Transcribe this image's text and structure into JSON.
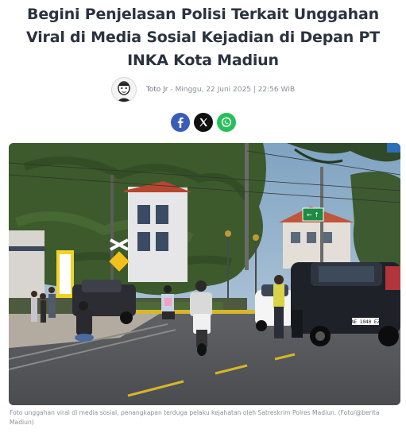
{
  "article": {
    "headline": "Begini Penjelasan Polisi Terkait Unggahan Viral di Media Sosial Kejadian di Depan PT INKA Kota Madiun",
    "author": "Toto Jr",
    "separator": " - ",
    "date": "Minggu, 22 Juni 2025 | 22:56 WIB",
    "caption": "Foto unggahan viral di media sosial, penangkapan terduga pelaku kejahatan oleh Satreskrim Polres Madiun. (Foto/@berita Madiun)"
  },
  "photo_signs": {
    "street_sign": "← ↑",
    "plate": "AE 1040 EZ"
  },
  "share": [
    {
      "network": "facebook",
      "icon": "facebook-icon",
      "color": "#3b5bb8"
    },
    {
      "network": "x",
      "icon": "x-icon",
      "color": "#111111"
    },
    {
      "network": "whatsapp",
      "icon": "whatsapp-icon",
      "color": "#25c05a"
    }
  ],
  "colors": {
    "headline": "#2b3340",
    "meta": "#8a8f98"
  }
}
